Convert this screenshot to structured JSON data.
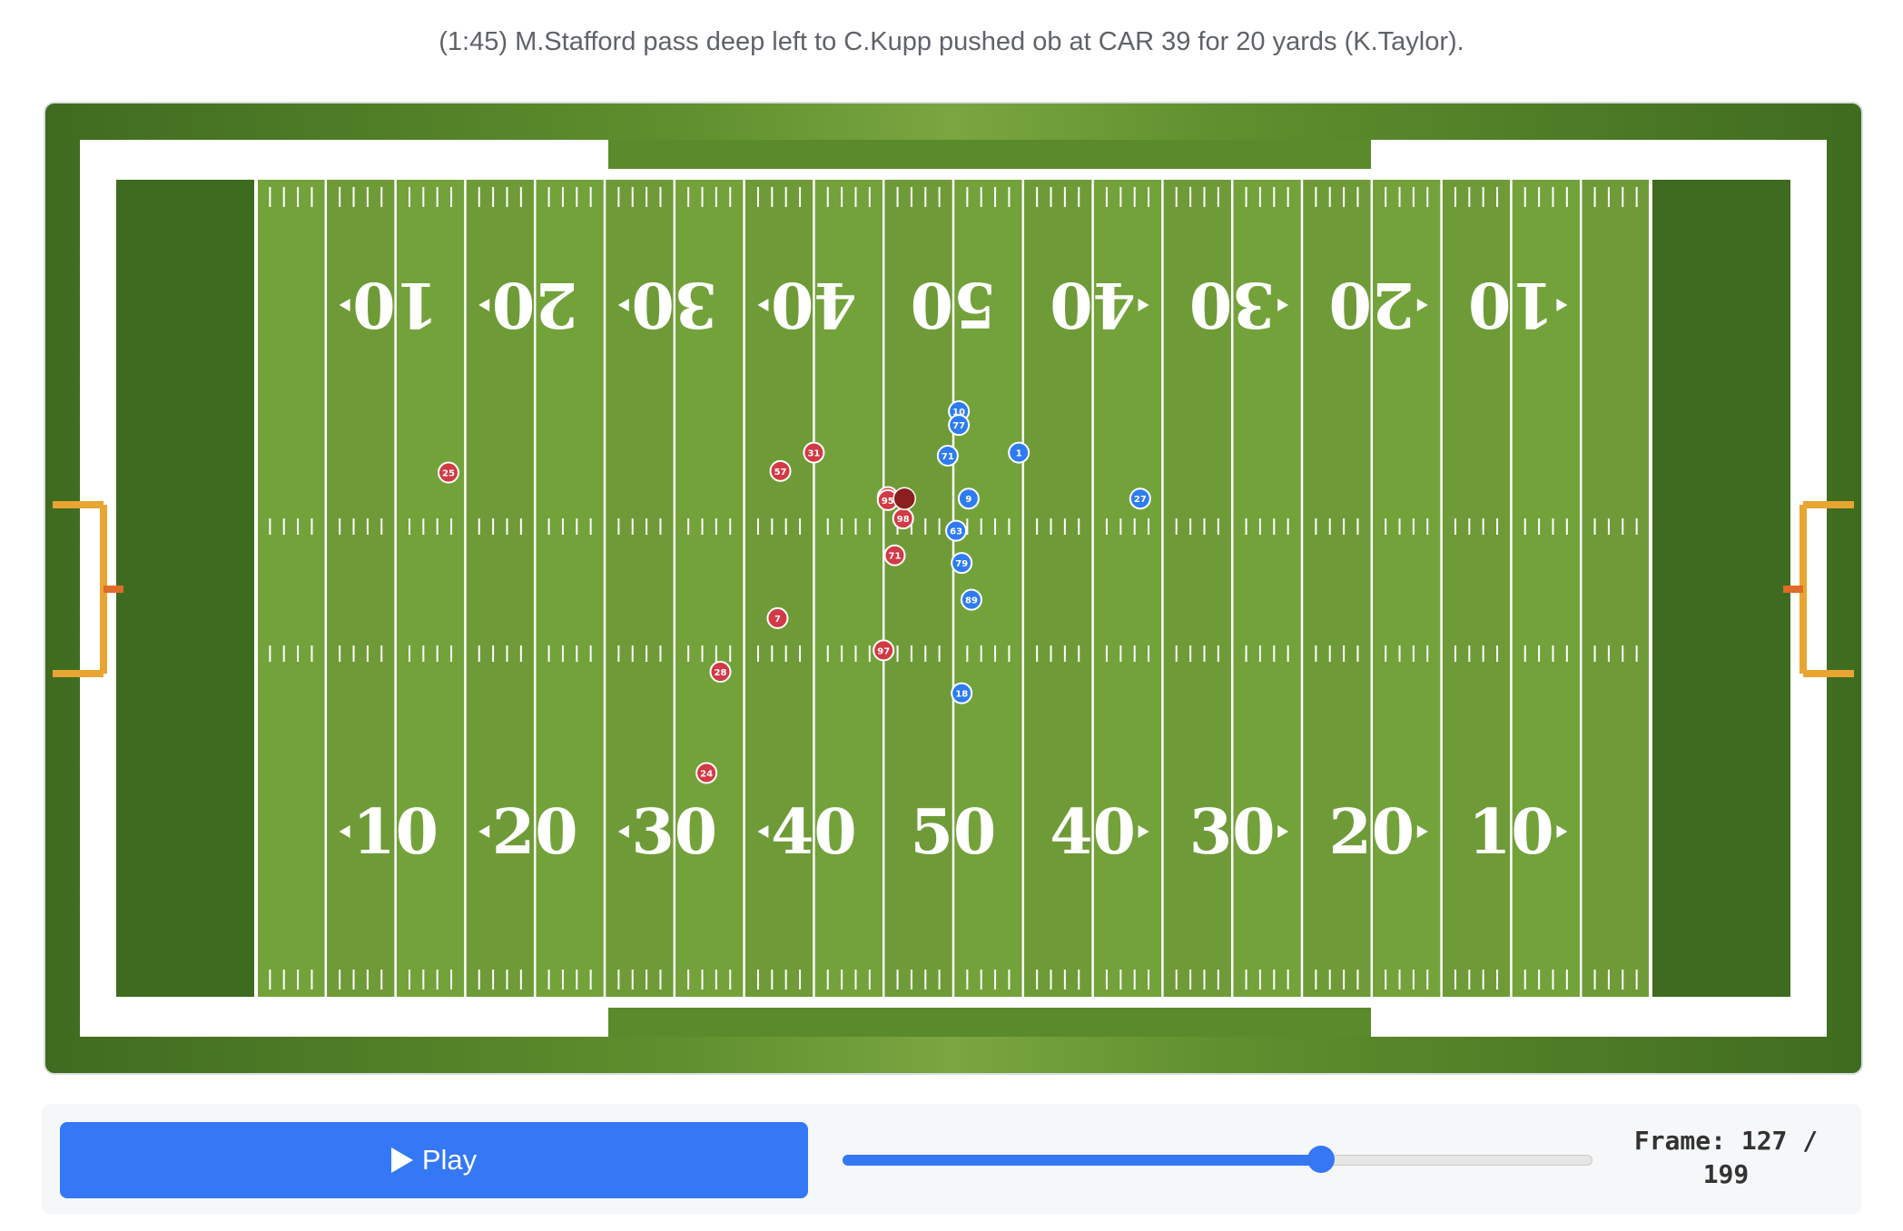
{
  "play_description": "(1:45) M.Stafford pass deep left to C.Kupp pushed ob at CAR 39 for 20 yards (K.Taylor).",
  "field": {
    "yard_numbers_top": [
      "10",
      "20",
      "30",
      "40",
      "50",
      "40",
      "30",
      "20",
      "10"
    ],
    "yard_numbers_bottom": [
      "10",
      "20",
      "30",
      "40",
      "50",
      "40",
      "30",
      "20",
      "10"
    ],
    "colors": {
      "turf": "#6e9b37",
      "endzone": "#3e6b1f",
      "lines": "#ffffff",
      "goalpost": "#e8a531"
    }
  },
  "players": {
    "defense_color": "#d23a45",
    "offense_color": "#2f7cf0",
    "football_color": "#8b1e1e",
    "defense": [
      {
        "jersey": "28",
        "x": 33.3,
        "y": 32.1
      },
      {
        "jersey": "31",
        "x": 40.0,
        "y": 17.8
      },
      {
        "jersey": "38",
        "x": 45.3,
        "y": 20.7
      },
      {
        "jersey": "98",
        "x": 46.4,
        "y": 22.1
      },
      {
        "jersey": "25",
        "x": 13.8,
        "y": 19.1
      },
      {
        "jersey": "57",
        "x": 37.6,
        "y": 19.0
      },
      {
        "jersey": "95",
        "x": 45.3,
        "y": 20.9
      },
      {
        "jersey": "71",
        "x": 45.8,
        "y": 24.5
      },
      {
        "jersey": "7",
        "x": 37.4,
        "y": 28.6
      },
      {
        "jersey": "97",
        "x": 45.0,
        "y": 30.7
      },
      {
        "jersey": "24",
        "x": 32.3,
        "y": 38.7
      }
    ],
    "offense": [
      {
        "jersey": "10",
        "x": 50.4,
        "y": 15.1
      },
      {
        "jersey": "1",
        "x": 54.7,
        "y": 17.8
      },
      {
        "jersey": "77",
        "x": 50.4,
        "y": 16.0
      },
      {
        "jersey": "71",
        "x": 49.6,
        "y": 18.0
      },
      {
        "jersey": "9",
        "x": 51.1,
        "y": 20.8
      },
      {
        "jersey": "27",
        "x": 63.4,
        "y": 20.8
      },
      {
        "jersey": "63",
        "x": 50.2,
        "y": 22.9
      },
      {
        "jersey": "79",
        "x": 50.6,
        "y": 25.0
      },
      {
        "jersey": "89",
        "x": 51.3,
        "y": 27.4
      },
      {
        "jersey": "18",
        "x": 50.6,
        "y": 33.5
      }
    ],
    "football": {
      "x": 46.5,
      "y": 20.8
    }
  },
  "controls": {
    "play_label": "Play",
    "slider_value": 127,
    "slider_max": 199,
    "frame_text": "Frame: 127 / 199"
  }
}
